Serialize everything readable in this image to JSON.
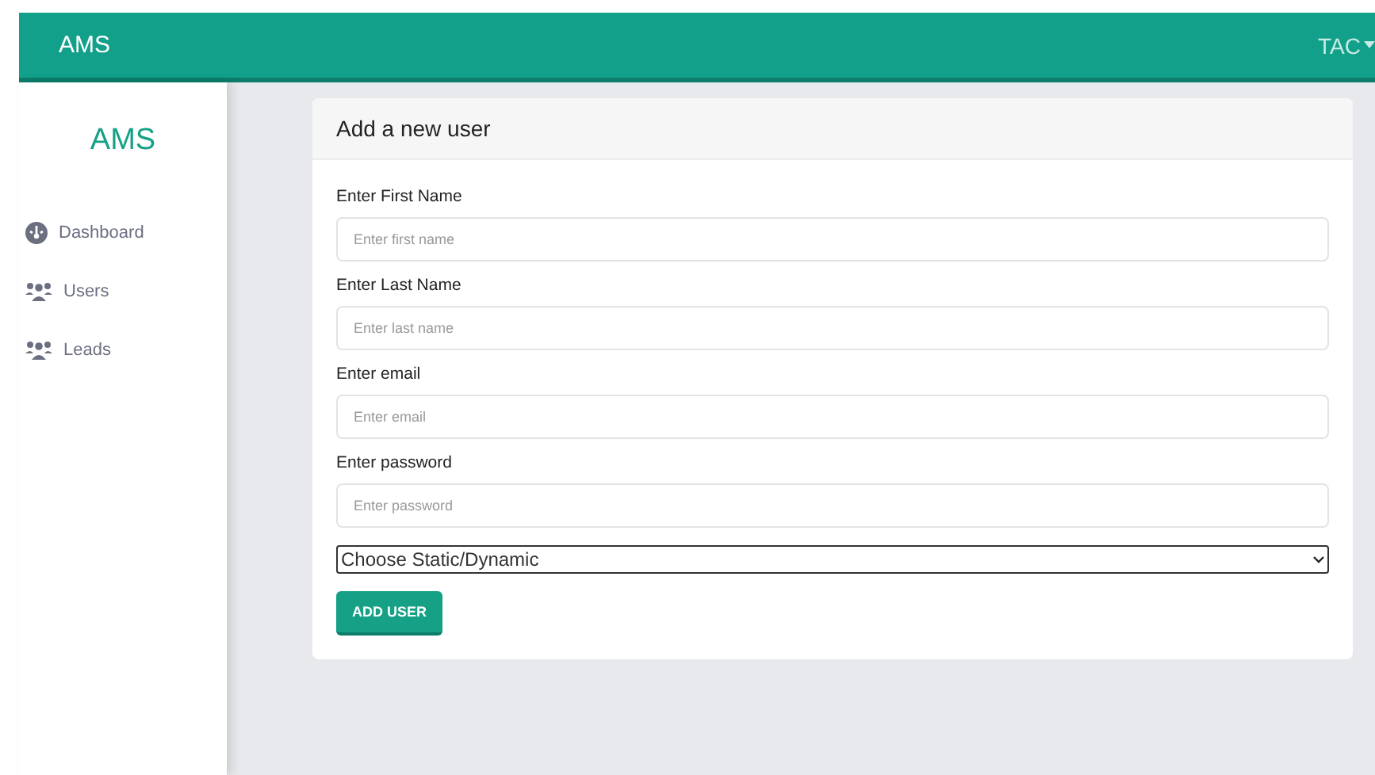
{
  "header": {
    "brand": "AMS",
    "user_menu": "TAC"
  },
  "sidebar": {
    "title": "AMS",
    "items": [
      {
        "label": "Dashboard",
        "kind": "gauge"
      },
      {
        "label": "Users",
        "kind": "people"
      },
      {
        "label": "Leads",
        "kind": "people"
      }
    ]
  },
  "form": {
    "title": "Add a new user",
    "fields": [
      {
        "label": "Enter First Name",
        "placeholder": "Enter first name"
      },
      {
        "label": "Enter Last Name",
        "placeholder": "Enter last name"
      },
      {
        "label": "Enter email",
        "placeholder": "Enter email"
      },
      {
        "label": "Enter password",
        "placeholder": "Enter password"
      }
    ],
    "select": {
      "value": "Choose Static/Dynamic"
    },
    "submit": "ADD USER"
  }
}
